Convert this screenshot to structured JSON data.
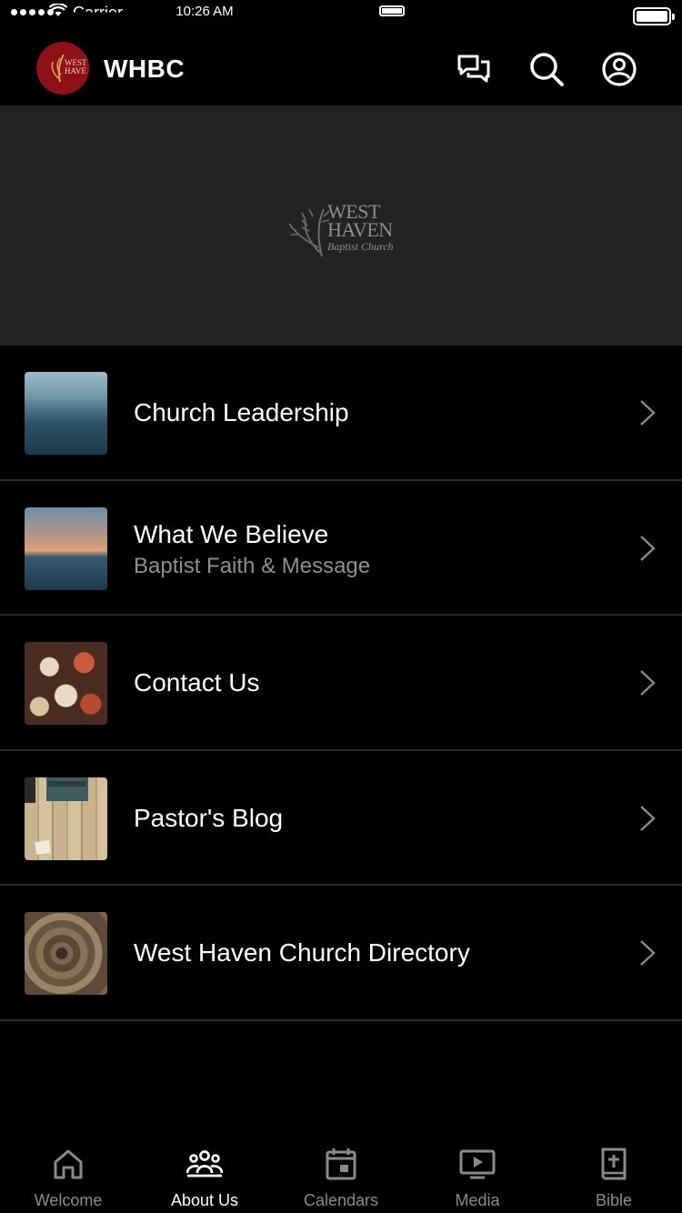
{
  "status_bar": {
    "carrier": "Carrier",
    "time": "10:26 AM"
  },
  "header": {
    "title": "WHBC",
    "logo_icon": "church-logo",
    "actions": [
      {
        "icon": "chat-bubbles-icon"
      },
      {
        "icon": "search-icon"
      },
      {
        "icon": "account-icon"
      }
    ]
  },
  "banner": {
    "logo_line1": "WEST",
    "logo_line2": "HAVEN",
    "logo_line3": "Baptist Church"
  },
  "list": {
    "items": [
      {
        "title": "Church Leadership",
        "subtitle": ""
      },
      {
        "title": "What We Believe",
        "subtitle": "Baptist Faith & Message"
      },
      {
        "title": "Contact Us",
        "subtitle": ""
      },
      {
        "title": "Pastor's Blog",
        "subtitle": ""
      },
      {
        "title": "West Haven Church Directory",
        "subtitle": ""
      }
    ]
  },
  "tabbar": {
    "tabs": [
      {
        "label": "Welcome",
        "icon": "home-icon",
        "active": false
      },
      {
        "label": "About Us",
        "icon": "people-icon",
        "active": true
      },
      {
        "label": "Calendars",
        "icon": "calendar-icon",
        "active": false
      },
      {
        "label": "Media",
        "icon": "play-screen-icon",
        "active": false
      },
      {
        "label": "Bible",
        "icon": "bible-icon",
        "active": false
      }
    ]
  },
  "colors": {
    "background": "#000000",
    "banner": "#232323",
    "brand_red": "#8e1218",
    "muted_text": "#8f8f8f",
    "inactive_tab": "#8a8a8a",
    "divider": "#2a2a2a"
  }
}
